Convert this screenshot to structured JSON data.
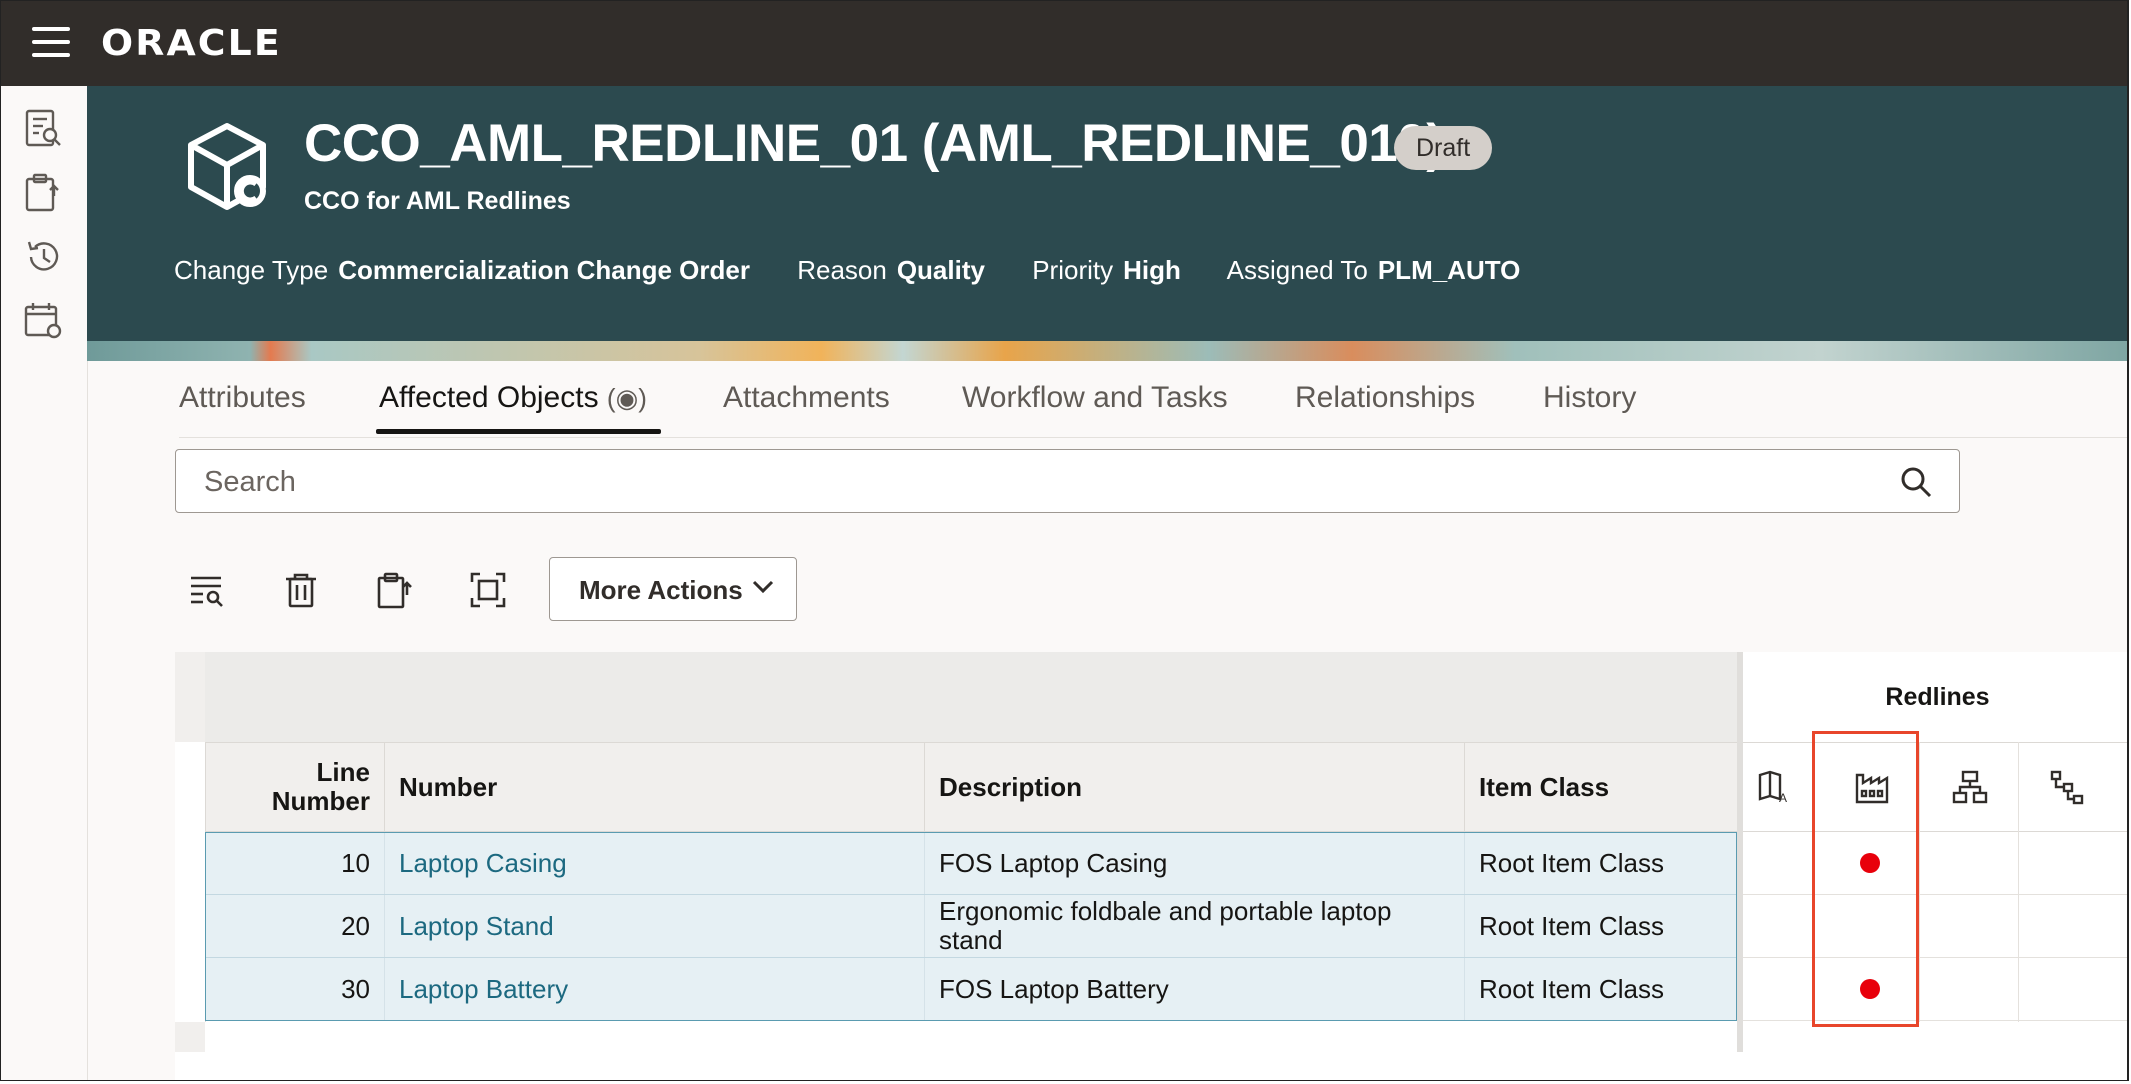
{
  "app": {
    "brand": "ORACLE"
  },
  "header": {
    "title": "CCO_AML_REDLINE_01 (AML_REDLINE_010)",
    "status_badge": "Draft",
    "subtitle": "CCO for AML Redlines",
    "meta": [
      {
        "label": "Change Type",
        "value": "Commercialization Change Order"
      },
      {
        "label": "Reason",
        "value": "Quality"
      },
      {
        "label": "Priority",
        "value": "High"
      },
      {
        "label": "Assigned To",
        "value": "PLM_AUTO"
      }
    ]
  },
  "tabs": [
    {
      "label": "Attributes"
    },
    {
      "label": "Affected Objects",
      "indicator": "(◉)",
      "active": true
    },
    {
      "label": "Attachments"
    },
    {
      "label": "Workflow and Tasks"
    },
    {
      "label": "Relationships"
    },
    {
      "label": "History"
    }
  ],
  "search": {
    "placeholder": "Search"
  },
  "toolbar": {
    "more_actions_label": "More Actions"
  },
  "table": {
    "redlines_group_label": "Redlines",
    "columns": {
      "line_number": "Line Number",
      "number": "Number",
      "description": "Description",
      "item_class": "Item Class"
    },
    "rows": [
      {
        "line_number": "10",
        "number": "Laptop Casing",
        "description": "FOS Laptop Casing",
        "item_class": "Root Item Class",
        "redline_mfg": true
      },
      {
        "line_number": "20",
        "number": "Laptop Stand",
        "description": "Ergonomic foldbale and portable laptop stand",
        "item_class": "Root Item Class",
        "redline_mfg": false
      },
      {
        "line_number": "30",
        "number": "Laptop Battery",
        "description": "FOS Laptop Battery",
        "item_class": "Root Item Class",
        "redline_mfg": true
      }
    ]
  },
  "colors": {
    "topbar": "#312d2a",
    "header": "#2c4a4f",
    "link": "#1c6980",
    "redline_dot": "#e8000b",
    "highlight": "#e8462b"
  }
}
